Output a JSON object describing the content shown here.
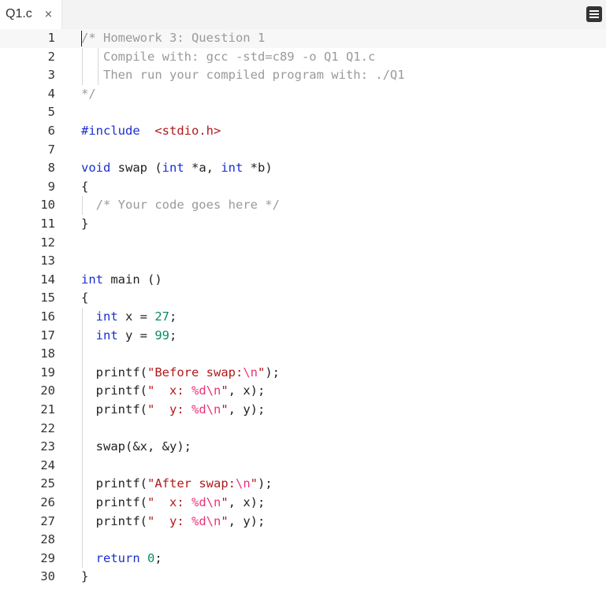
{
  "tab": {
    "label": "Q1.c",
    "close": "×"
  },
  "menu": {
    "icon": "hamburger-menu-icon"
  },
  "lines": [
    [
      [
        "c",
        "/* Homework 3: Question 1"
      ]
    ],
    [
      [
        "c",
        "   Compile with: gcc -std=c89 -o Q1 Q1.c"
      ]
    ],
    [
      [
        "c",
        "   Then run your compiled program with: ./Q1"
      ]
    ],
    [
      [
        "c",
        "*/"
      ]
    ],
    [],
    [
      [
        "kw",
        "#include"
      ],
      [
        "",
        "  "
      ],
      [
        "str",
        "<stdio.h>"
      ]
    ],
    [],
    [
      [
        "kw",
        "void"
      ],
      [
        "",
        " swap ("
      ],
      [
        "kw",
        "int"
      ],
      [
        "",
        " *a, "
      ],
      [
        "kw",
        "int"
      ],
      [
        "",
        " *b)"
      ]
    ],
    [
      [
        "",
        "{"
      ]
    ],
    [
      [
        "c",
        "  /* Your code goes here */"
      ]
    ],
    [
      [
        "",
        "}"
      ]
    ],
    [],
    [],
    [
      [
        "kw",
        "int"
      ],
      [
        "",
        " main ()"
      ]
    ],
    [
      [
        "",
        "{"
      ]
    ],
    [
      [
        "kw",
        "  int"
      ],
      [
        "",
        " x = "
      ],
      [
        "num",
        "27"
      ],
      [
        "",
        ";"
      ]
    ],
    [
      [
        "kw",
        "  int"
      ],
      [
        "",
        " y = "
      ],
      [
        "num",
        "99"
      ],
      [
        "",
        ";"
      ]
    ],
    [],
    [
      [
        "",
        "  printf("
      ],
      [
        "str",
        "\"Before swap:"
      ],
      [
        "esc",
        "\\n"
      ],
      [
        "str",
        "\""
      ],
      [
        "",
        ");"
      ]
    ],
    [
      [
        "",
        "  printf("
      ],
      [
        "str",
        "\"  x: "
      ],
      [
        "esc",
        "%d\\n"
      ],
      [
        "str",
        "\""
      ],
      [
        "",
        ", x);"
      ]
    ],
    [
      [
        "",
        "  printf("
      ],
      [
        "str",
        "\"  y: "
      ],
      [
        "esc",
        "%d\\n"
      ],
      [
        "str",
        "\""
      ],
      [
        "",
        ", y);"
      ]
    ],
    [],
    [
      [
        "",
        "  swap(&x, &y);"
      ]
    ],
    [],
    [
      [
        "",
        "  printf("
      ],
      [
        "str",
        "\"After swap:"
      ],
      [
        "esc",
        "\\n"
      ],
      [
        "str",
        "\""
      ],
      [
        "",
        ");"
      ]
    ],
    [
      [
        "",
        "  printf("
      ],
      [
        "str",
        "\"  x: "
      ],
      [
        "esc",
        "%d\\n"
      ],
      [
        "str",
        "\""
      ],
      [
        "",
        ", x);"
      ]
    ],
    [
      [
        "",
        "  printf("
      ],
      [
        "str",
        "\"  y: "
      ],
      [
        "esc",
        "%d\\n"
      ],
      [
        "str",
        "\""
      ],
      [
        "",
        ", y);"
      ]
    ],
    [],
    [
      [
        "kw",
        "  return"
      ],
      [
        "",
        " "
      ],
      [
        "num",
        "0"
      ],
      [
        "",
        ";"
      ]
    ],
    [
      [
        "",
        "}"
      ]
    ]
  ]
}
